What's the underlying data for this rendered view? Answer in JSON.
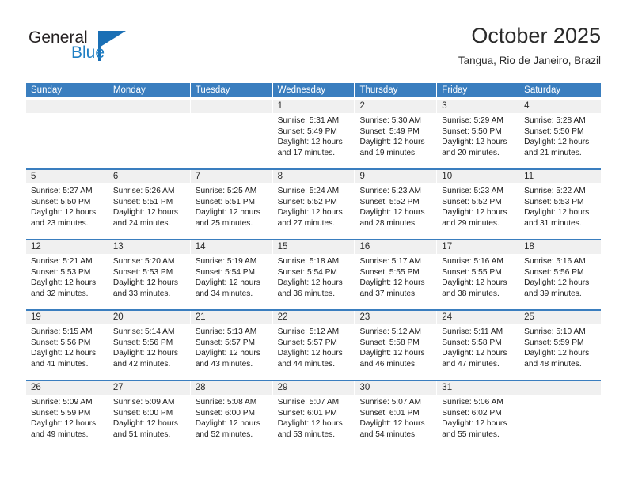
{
  "brand": {
    "name_part1": "General",
    "name_part2": "Blue",
    "logo_icon": "triangle-flag-icon",
    "accent_color": "#1a6fb5"
  },
  "header": {
    "title": "October 2025",
    "location": "Tangua, Rio de Janeiro, Brazil"
  },
  "calendar": {
    "header_color": "#3a7ebf",
    "weekdays": [
      "Sunday",
      "Monday",
      "Tuesday",
      "Wednesday",
      "Thursday",
      "Friday",
      "Saturday"
    ],
    "weeks": [
      [
        {
          "day": "",
          "sunrise": "",
          "sunset": "",
          "daylight1": "",
          "daylight2": ""
        },
        {
          "day": "",
          "sunrise": "",
          "sunset": "",
          "daylight1": "",
          "daylight2": ""
        },
        {
          "day": "",
          "sunrise": "",
          "sunset": "",
          "daylight1": "",
          "daylight2": ""
        },
        {
          "day": "1",
          "sunrise": "Sunrise: 5:31 AM",
          "sunset": "Sunset: 5:49 PM",
          "daylight1": "Daylight: 12 hours",
          "daylight2": "and 17 minutes."
        },
        {
          "day": "2",
          "sunrise": "Sunrise: 5:30 AM",
          "sunset": "Sunset: 5:49 PM",
          "daylight1": "Daylight: 12 hours",
          "daylight2": "and 19 minutes."
        },
        {
          "day": "3",
          "sunrise": "Sunrise: 5:29 AM",
          "sunset": "Sunset: 5:50 PM",
          "daylight1": "Daylight: 12 hours",
          "daylight2": "and 20 minutes."
        },
        {
          "day": "4",
          "sunrise": "Sunrise: 5:28 AM",
          "sunset": "Sunset: 5:50 PM",
          "daylight1": "Daylight: 12 hours",
          "daylight2": "and 21 minutes."
        }
      ],
      [
        {
          "day": "5",
          "sunrise": "Sunrise: 5:27 AM",
          "sunset": "Sunset: 5:50 PM",
          "daylight1": "Daylight: 12 hours",
          "daylight2": "and 23 minutes."
        },
        {
          "day": "6",
          "sunrise": "Sunrise: 5:26 AM",
          "sunset": "Sunset: 5:51 PM",
          "daylight1": "Daylight: 12 hours",
          "daylight2": "and 24 minutes."
        },
        {
          "day": "7",
          "sunrise": "Sunrise: 5:25 AM",
          "sunset": "Sunset: 5:51 PM",
          "daylight1": "Daylight: 12 hours",
          "daylight2": "and 25 minutes."
        },
        {
          "day": "8",
          "sunrise": "Sunrise: 5:24 AM",
          "sunset": "Sunset: 5:52 PM",
          "daylight1": "Daylight: 12 hours",
          "daylight2": "and 27 minutes."
        },
        {
          "day": "9",
          "sunrise": "Sunrise: 5:23 AM",
          "sunset": "Sunset: 5:52 PM",
          "daylight1": "Daylight: 12 hours",
          "daylight2": "and 28 minutes."
        },
        {
          "day": "10",
          "sunrise": "Sunrise: 5:23 AM",
          "sunset": "Sunset: 5:52 PM",
          "daylight1": "Daylight: 12 hours",
          "daylight2": "and 29 minutes."
        },
        {
          "day": "11",
          "sunrise": "Sunrise: 5:22 AM",
          "sunset": "Sunset: 5:53 PM",
          "daylight1": "Daylight: 12 hours",
          "daylight2": "and 31 minutes."
        }
      ],
      [
        {
          "day": "12",
          "sunrise": "Sunrise: 5:21 AM",
          "sunset": "Sunset: 5:53 PM",
          "daylight1": "Daylight: 12 hours",
          "daylight2": "and 32 minutes."
        },
        {
          "day": "13",
          "sunrise": "Sunrise: 5:20 AM",
          "sunset": "Sunset: 5:53 PM",
          "daylight1": "Daylight: 12 hours",
          "daylight2": "and 33 minutes."
        },
        {
          "day": "14",
          "sunrise": "Sunrise: 5:19 AM",
          "sunset": "Sunset: 5:54 PM",
          "daylight1": "Daylight: 12 hours",
          "daylight2": "and 34 minutes."
        },
        {
          "day": "15",
          "sunrise": "Sunrise: 5:18 AM",
          "sunset": "Sunset: 5:54 PM",
          "daylight1": "Daylight: 12 hours",
          "daylight2": "and 36 minutes."
        },
        {
          "day": "16",
          "sunrise": "Sunrise: 5:17 AM",
          "sunset": "Sunset: 5:55 PM",
          "daylight1": "Daylight: 12 hours",
          "daylight2": "and 37 minutes."
        },
        {
          "day": "17",
          "sunrise": "Sunrise: 5:16 AM",
          "sunset": "Sunset: 5:55 PM",
          "daylight1": "Daylight: 12 hours",
          "daylight2": "and 38 minutes."
        },
        {
          "day": "18",
          "sunrise": "Sunrise: 5:16 AM",
          "sunset": "Sunset: 5:56 PM",
          "daylight1": "Daylight: 12 hours",
          "daylight2": "and 39 minutes."
        }
      ],
      [
        {
          "day": "19",
          "sunrise": "Sunrise: 5:15 AM",
          "sunset": "Sunset: 5:56 PM",
          "daylight1": "Daylight: 12 hours",
          "daylight2": "and 41 minutes."
        },
        {
          "day": "20",
          "sunrise": "Sunrise: 5:14 AM",
          "sunset": "Sunset: 5:56 PM",
          "daylight1": "Daylight: 12 hours",
          "daylight2": "and 42 minutes."
        },
        {
          "day": "21",
          "sunrise": "Sunrise: 5:13 AM",
          "sunset": "Sunset: 5:57 PM",
          "daylight1": "Daylight: 12 hours",
          "daylight2": "and 43 minutes."
        },
        {
          "day": "22",
          "sunrise": "Sunrise: 5:12 AM",
          "sunset": "Sunset: 5:57 PM",
          "daylight1": "Daylight: 12 hours",
          "daylight2": "and 44 minutes."
        },
        {
          "day": "23",
          "sunrise": "Sunrise: 5:12 AM",
          "sunset": "Sunset: 5:58 PM",
          "daylight1": "Daylight: 12 hours",
          "daylight2": "and 46 minutes."
        },
        {
          "day": "24",
          "sunrise": "Sunrise: 5:11 AM",
          "sunset": "Sunset: 5:58 PM",
          "daylight1": "Daylight: 12 hours",
          "daylight2": "and 47 minutes."
        },
        {
          "day": "25",
          "sunrise": "Sunrise: 5:10 AM",
          "sunset": "Sunset: 5:59 PM",
          "daylight1": "Daylight: 12 hours",
          "daylight2": "and 48 minutes."
        }
      ],
      [
        {
          "day": "26",
          "sunrise": "Sunrise: 5:09 AM",
          "sunset": "Sunset: 5:59 PM",
          "daylight1": "Daylight: 12 hours",
          "daylight2": "and 49 minutes."
        },
        {
          "day": "27",
          "sunrise": "Sunrise: 5:09 AM",
          "sunset": "Sunset: 6:00 PM",
          "daylight1": "Daylight: 12 hours",
          "daylight2": "and 51 minutes."
        },
        {
          "day": "28",
          "sunrise": "Sunrise: 5:08 AM",
          "sunset": "Sunset: 6:00 PM",
          "daylight1": "Daylight: 12 hours",
          "daylight2": "and 52 minutes."
        },
        {
          "day": "29",
          "sunrise": "Sunrise: 5:07 AM",
          "sunset": "Sunset: 6:01 PM",
          "daylight1": "Daylight: 12 hours",
          "daylight2": "and 53 minutes."
        },
        {
          "day": "30",
          "sunrise": "Sunrise: 5:07 AM",
          "sunset": "Sunset: 6:01 PM",
          "daylight1": "Daylight: 12 hours",
          "daylight2": "and 54 minutes."
        },
        {
          "day": "31",
          "sunrise": "Sunrise: 5:06 AM",
          "sunset": "Sunset: 6:02 PM",
          "daylight1": "Daylight: 12 hours",
          "daylight2": "and 55 minutes."
        },
        {
          "day": "",
          "sunrise": "",
          "sunset": "",
          "daylight1": "",
          "daylight2": ""
        }
      ]
    ]
  }
}
